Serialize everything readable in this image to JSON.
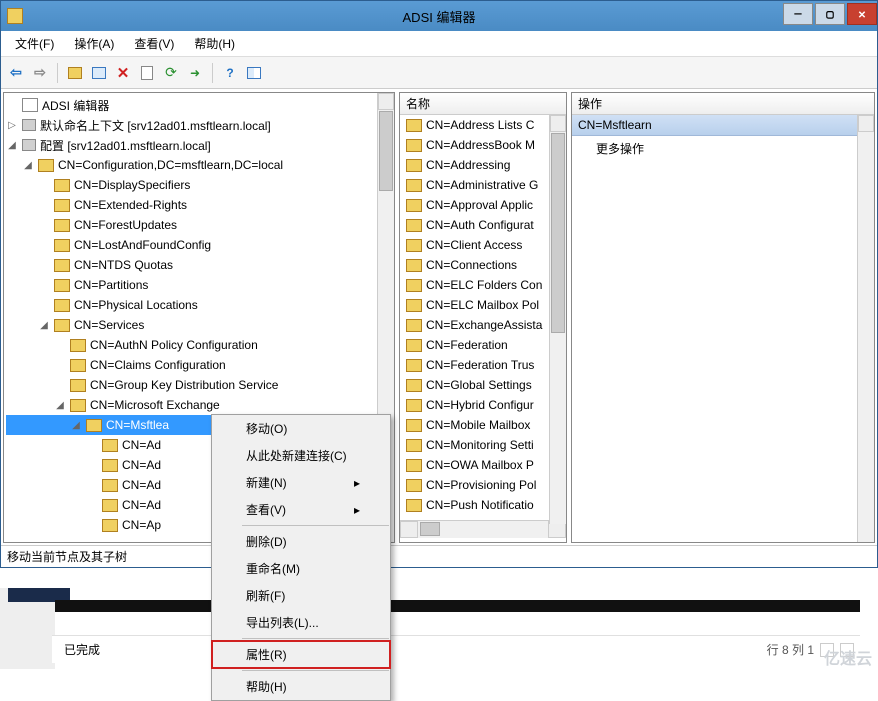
{
  "window": {
    "title": "ADSI 编辑器"
  },
  "menubar": [
    {
      "label": "文件(F)"
    },
    {
      "label": "操作(A)"
    },
    {
      "label": "查看(V)"
    },
    {
      "label": "帮助(H)"
    }
  ],
  "toolbar_icons": [
    "back-icon",
    "forward-icon",
    "sep",
    "up-folder-icon",
    "properties-pane-icon",
    "delete-icon",
    "copy-icon",
    "refresh-icon",
    "export-icon",
    "sep",
    "help-icon",
    "show-hide-icon"
  ],
  "tree": {
    "root": "ADSI 编辑器",
    "ctx": "默认命名上下文 [srv12ad01.msftlearn.local]",
    "cfg": "配置 [srv12ad01.msftlearn.local]",
    "cfgdn": "CN=Configuration,DC=msftlearn,DC=local",
    "cfg_children": [
      "CN=DisplaySpecifiers",
      "CN=Extended-Rights",
      "CN=ForestUpdates",
      "CN=LostAndFoundConfig",
      "CN=NTDS Quotas",
      "CN=Partitions",
      "CN=Physical Locations"
    ],
    "services": "CN=Services",
    "svc_children": [
      "CN=AuthN Policy Configuration",
      "CN=Claims Configuration",
      "CN=Group Key Distribution Service"
    ],
    "mse": "CN=Microsoft Exchange",
    "selected": "CN=Msftlea",
    "sel_children": [
      "CN=Ad",
      "CN=Ad",
      "CN=Ad",
      "CN=Ad",
      "CN=Ap"
    ]
  },
  "list": {
    "header": "名称",
    "rows": [
      "CN=Address Lists C",
      "CN=AddressBook M",
      "CN=Addressing",
      "CN=Administrative G",
      "CN=Approval Applic",
      "CN=Auth Configurat",
      "CN=Client Access",
      "CN=Connections",
      "CN=ELC Folders Con",
      "CN=ELC Mailbox Pol",
      "CN=ExchangeAssista",
      "CN=Federation",
      "CN=Federation Trus",
      "CN=Global Settings",
      "CN=Hybrid Configur",
      "CN=Mobile Mailbox",
      "CN=Monitoring Setti",
      "CN=OWA Mailbox P",
      "CN=Provisioning Pol",
      "CN=Push Notificatio"
    ]
  },
  "actions": {
    "header": "操作",
    "selected": "CN=Msftlearn",
    "more": "更多操作"
  },
  "context_menu": [
    {
      "label": "移动(O)"
    },
    {
      "label": "从此处新建连接(C)"
    },
    {
      "label": "新建(N)",
      "sub": true
    },
    {
      "label": "查看(V)",
      "sub": true
    },
    {
      "sep": true
    },
    {
      "label": "删除(D)"
    },
    {
      "label": "重命名(M)"
    },
    {
      "label": "刷新(F)"
    },
    {
      "label": "导出列表(L)..."
    },
    {
      "sep": true
    },
    {
      "label": "属性(R)",
      "hl": true
    },
    {
      "sep": true
    },
    {
      "label": "帮助(H)"
    }
  ],
  "status": "移动当前节点及其子树",
  "bottom": {
    "status": "已完成",
    "pos": "行 8  列 1"
  }
}
